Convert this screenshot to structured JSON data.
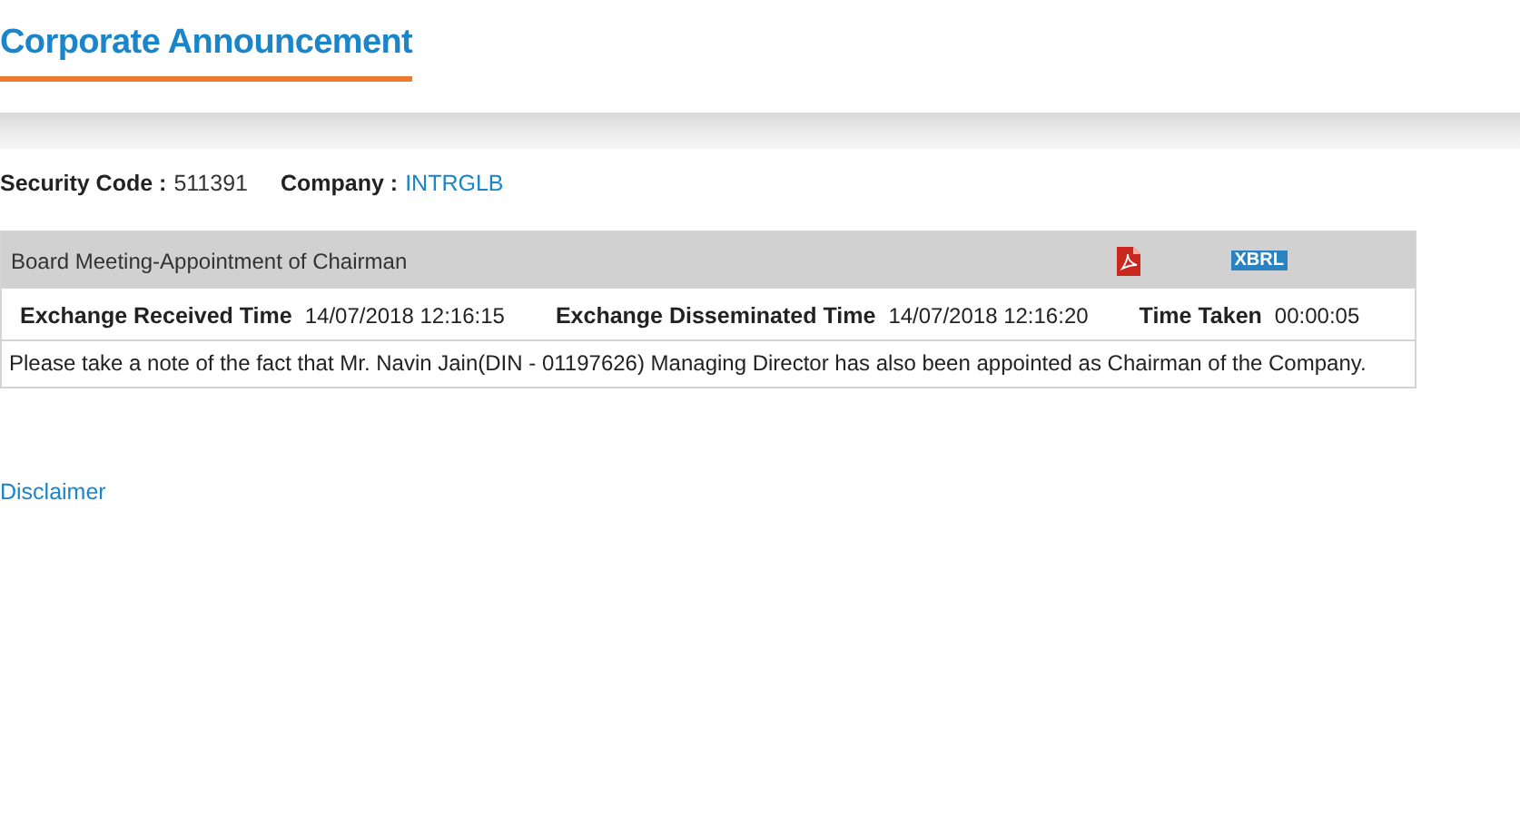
{
  "title": "Corporate Announcement",
  "security": {
    "code_label": "Security Code :",
    "code": "511391",
    "company_label": "Company :",
    "company": "INTRGLB"
  },
  "announcement": {
    "subject": "Board Meeting-Appointment of Chairman",
    "xbrl": "XBRL",
    "times": [
      {
        "label": "Exchange Received Time",
        "value": "14/07/2018 12:16:15"
      },
      {
        "label": "Exchange Disseminated Time",
        "value": "14/07/2018 12:16:20"
      },
      {
        "label": "Time Taken",
        "value": "00:00:05"
      }
    ],
    "body": "Please take a note of the fact that Mr. Navin Jain(DIN - 01197626) Managing Director has also been appointed as Chairman of the Company."
  },
  "disclaimer": "Disclaimer"
}
